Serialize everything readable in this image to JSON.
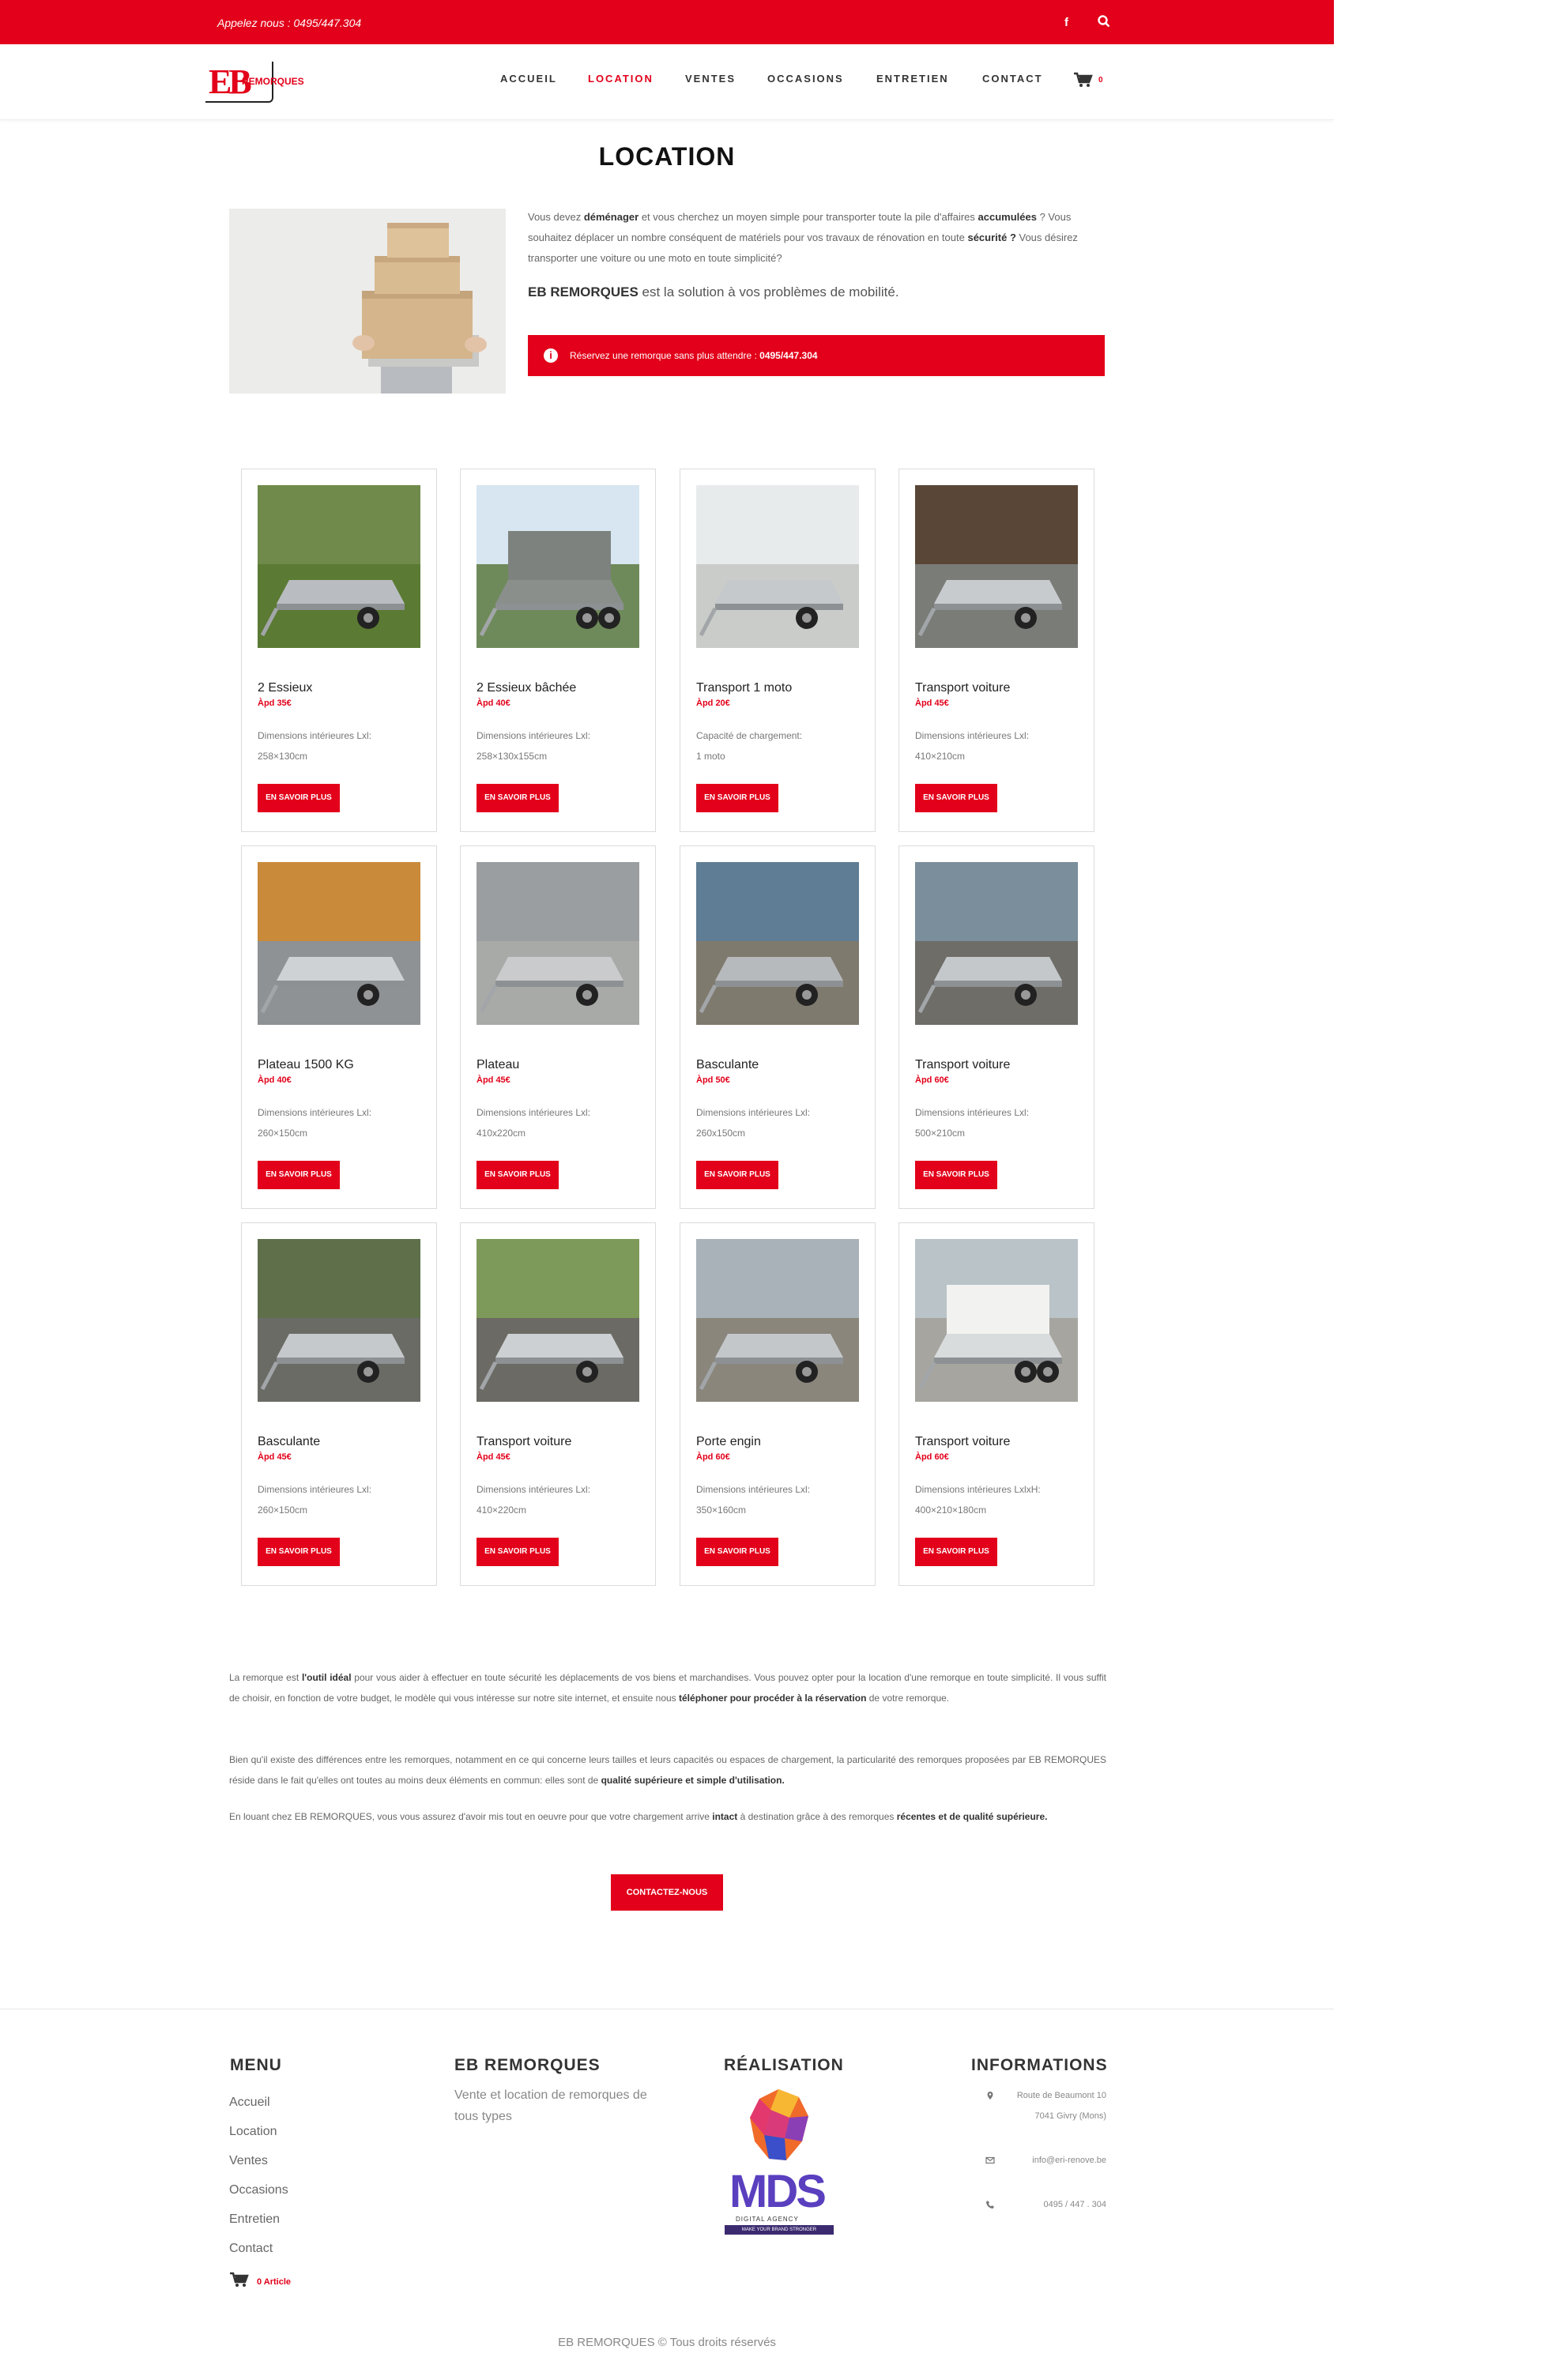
{
  "topbar": {
    "phone": "Appelez nous : 0495/447.304",
    "social_icon": "facebook-icon",
    "search_icon": "search-icon"
  },
  "logo": {
    "letters": "EB",
    "text": "REMORQUES"
  },
  "nav": {
    "items": [
      "ACCUEIL",
      "LOCATION",
      "VENTES",
      "OCCASIONS",
      "ENTRETIEN",
      "CONTACT"
    ],
    "active": "LOCATION",
    "cart_count": "0"
  },
  "page": {
    "title": "LOCATION"
  },
  "intro": {
    "p1_a": "Vous devez ",
    "p1_b": "déménager",
    "p1_c": " et vous cherchez un moyen simple pour transporter toute la pile d'affaires ",
    "p1_d": "accumulées",
    "p1_e": " ? Vous souhaitez déplacer un nombre conséquent de matériels pour vos travaux de rénovation en toute ",
    "p1_f": "sécurité ?",
    "p1_g": " Vous désirez transporter une voiture ou une moto en toute simplicité?",
    "p2_a": "EB REMORQUES",
    "p2_b": " est la solution à vos problèmes de mobilité.",
    "alert_a": "Réservez une remorque sans plus attendre : ",
    "alert_b": "0495/447.304"
  },
  "products": [
    {
      "name": "2 Essieux",
      "price": "Àpd 35€",
      "d1": "Dimensions intérieures Lxl:",
      "d2": "258×130cm",
      "btn": "EN SAVOIR PLUS"
    },
    {
      "name": "2 Essieux bâchée",
      "price": "Àpd 40€",
      "d1": "Dimensions intérieures Lxl:",
      "d2": "258×130x155cm",
      "btn": "EN SAVOIR PLUS"
    },
    {
      "name": "Transport 1 moto",
      "price": "Àpd 20€",
      "d1": "Capacité de chargement:",
      "d2": "1 moto",
      "btn": "EN SAVOIR PLUS"
    },
    {
      "name": "Transport voiture",
      "price": "Àpd 45€",
      "d1": "Dimensions intérieures Lxl:",
      "d2": "410×210cm",
      "btn": "EN SAVOIR PLUS"
    },
    {
      "name": "Plateau 1500 KG",
      "price": "Àpd 40€",
      "d1": "Dimensions intérieures Lxl:",
      "d2": "260×150cm",
      "btn": "EN SAVOIR PLUS"
    },
    {
      "name": "Plateau",
      "price": "Àpd 45€",
      "d1": "Dimensions intérieures Lxl:",
      "d2": "410x220cm",
      "btn": "EN SAVOIR PLUS"
    },
    {
      "name": "Basculante",
      "price": "Àpd 50€",
      "d1": "Dimensions intérieures Lxl:",
      "d2": "260x150cm",
      "btn": "EN SAVOIR PLUS"
    },
    {
      "name": "Transport voiture",
      "price": "Àpd 60€",
      "d1": "Dimensions intérieures Lxl:",
      "d2": "500×210cm",
      "btn": "EN SAVOIR PLUS"
    },
    {
      "name": "Basculante",
      "price": "Àpd 45€",
      "d1": "Dimensions intérieures Lxl:",
      "d2": "260×150cm",
      "btn": "EN SAVOIR PLUS"
    },
    {
      "name": "Transport voiture",
      "price": "Àpd 45€",
      "d1": "Dimensions intérieures Lxl:",
      "d2": "410×220cm",
      "btn": "EN SAVOIR PLUS"
    },
    {
      "name": "Porte engin",
      "price": "Àpd 60€",
      "d1": "Dimensions intérieures Lxl:",
      "d2": "350×160cm",
      "btn": "EN SAVOIR PLUS"
    },
    {
      "name": "Transport voiture",
      "price": "Àpd 60€",
      "d1": "Dimensions intérieures LxlxH:",
      "d2": "400×210×180cm",
      "btn": "EN SAVOIR PLUS"
    }
  ],
  "body_text": {
    "a1": "La remorque est ",
    "a2": "l'outil idéal",
    "a3": " pour vous aider à effectuer en toute sécurité les déplacements de vos biens et marchandises. Vous pouvez opter pour la location d'une remorque en toute simplicité. Il vous suffit de choisir, en fonction de votre budget, le modèle qui vous intéresse sur notre site internet, et ensuite nous ",
    "a4": "téléphoner pour procéder à la réservation",
    "a5": " de votre remorque.",
    "b1": "Bien qu'il existe des différences entre les remorques, notamment en ce qui concerne leurs tailles et leurs capacités ou espaces de chargement, la particularité des remorques proposées par EB REMORQUES réside dans le fait qu'elles ont toutes au moins deux éléments en commun: elles sont de ",
    "b2": "qualité supérieure et simple d'utilisation.",
    "c1": "En louant chez EB REMORQUES, vous vous assurez d'avoir mis tout en oeuvre pour que votre chargement arrive ",
    "c2": "intact",
    "c3": " à destination grâce à des remorques ",
    "c4": "récentes et de qualité supérieure.",
    "button": "CONTACTEZ-NOUS"
  },
  "footer": {
    "menu_title": "MENU",
    "menu": [
      "Accueil",
      "Location",
      "Ventes",
      "Occasions",
      "Entretien",
      "Contact"
    ],
    "cart_label": "0 Article",
    "about_title": "EB REMORQUES",
    "about_text": "Vente et location de remorques de tous types",
    "real_title": "RÉALISATION",
    "mds_text": "MDS",
    "mds_sub": "DIGITAL AGENCY",
    "mds_tag": "MAKE YOUR BRAND STRONGER",
    "info_title": "INFORMATIONS",
    "addr1": "Route de Beaumont 10",
    "addr2": "7041 Givry (Mons)",
    "email": "info@eri-renove.be",
    "phone": "0495 / 447 . 304",
    "copyright": "EB REMORQUES © Tous droits réservés"
  },
  "colors": {
    "brand_red": "#e2001a",
    "text": "#555555"
  }
}
